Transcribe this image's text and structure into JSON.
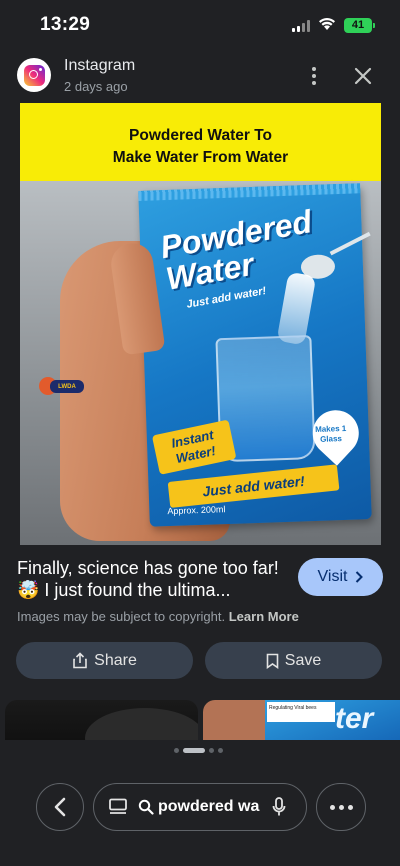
{
  "status": {
    "time": "13:29",
    "battery": "41"
  },
  "source": {
    "name": "Instagram",
    "time": "2 days ago"
  },
  "image": {
    "banner_line1": "Powdered Water To",
    "banner_line2": "Make Water From Water",
    "pack_title": "Powdered Water",
    "pack_tagline": "Just add water!",
    "badge_instant": "Instant Water!",
    "badge_makes": "Makes 1 Glass",
    "ribbon": "Just add water!",
    "size": "Approx. 200ml",
    "sticker": "LWDA LAHSUN"
  },
  "result": {
    "caption": "Finally, science has gone too far! 🤯 I just found the ultima...",
    "visit_label": "Visit",
    "copyright": "Images may be subject to copyright.",
    "learn_more": "Learn More"
  },
  "actions": {
    "share_label": "Share",
    "save_label": "Save"
  },
  "related": {
    "note_text": "Regulating Viral bees"
  },
  "search": {
    "query": "powdered wa"
  },
  "colors": {
    "background": "#202124",
    "visit_button": "#a8c7fa",
    "pill": "#37404d",
    "banner": "#f8ec06",
    "pack": "#1677c5"
  }
}
